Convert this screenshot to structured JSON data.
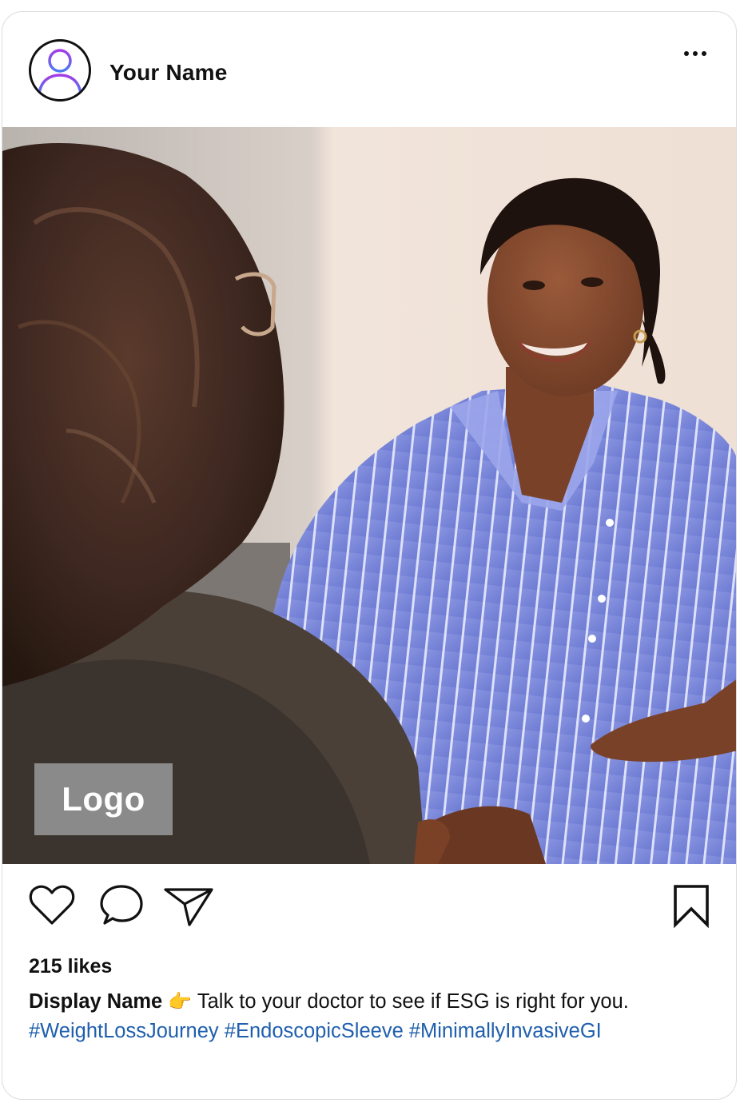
{
  "header": {
    "username": "Your Name",
    "avatar_icon": "user-icon",
    "more_icon": "more-horizontal-icon"
  },
  "photo": {
    "logo_label": "Logo"
  },
  "actions": {
    "like_icon": "heart-icon",
    "comment_icon": "comment-bubble-icon",
    "share_icon": "paper-plane-icon",
    "save_icon": "bookmark-icon"
  },
  "post": {
    "likes": "215 likes",
    "display_name": "Display Name",
    "emoji": "👉",
    "caption_text": " Talk to your doctor to see if ESG is right for you. ",
    "hashtags": [
      "#WeightLossJourney",
      "#EndoscopicSleeve",
      "#MinimallyInvasiveGI"
    ]
  },
  "colors": {
    "hashtag": "#1f5fae",
    "avatar_gradient_start": "#a43ce6",
    "avatar_gradient_end": "#4a7cf0",
    "logo_bg": "#8a8a8a"
  }
}
